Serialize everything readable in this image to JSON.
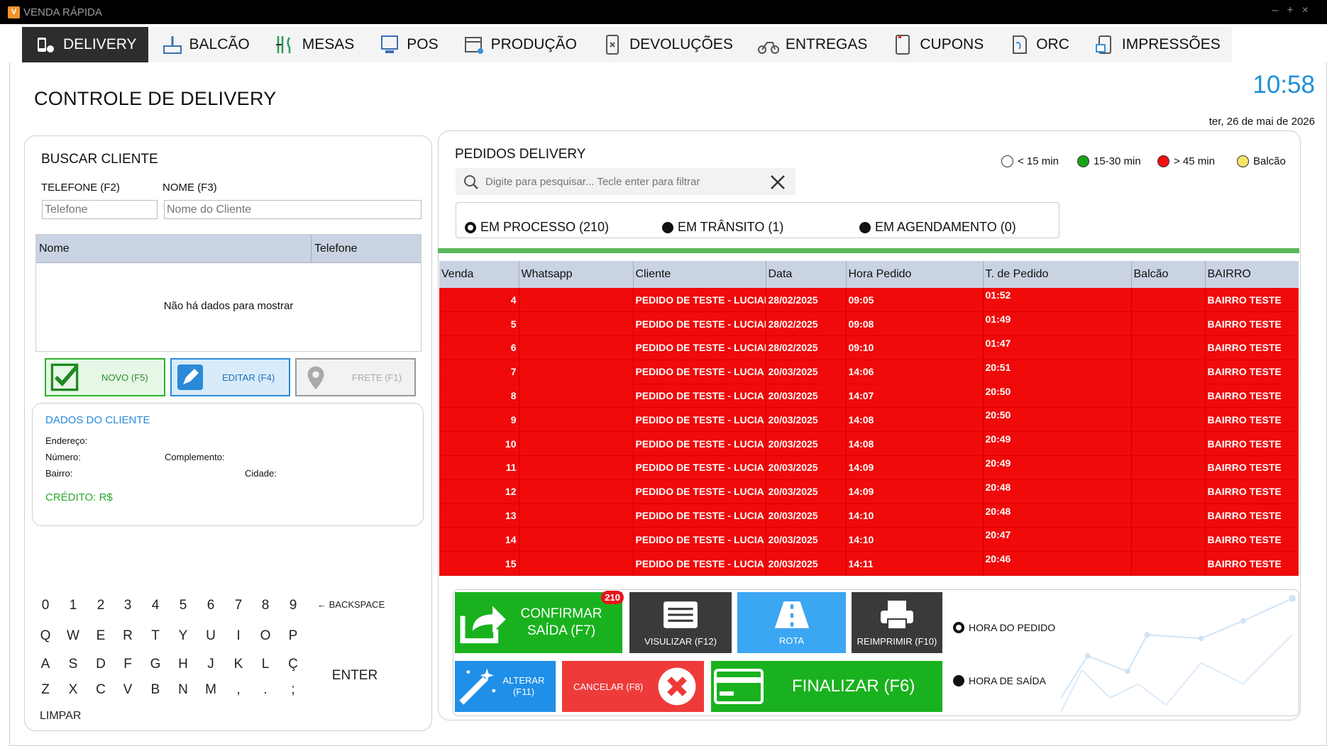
{
  "window": {
    "title": "VENDA RÁPIDA",
    "controls": [
      "–",
      "+",
      "×"
    ]
  },
  "tabs": [
    {
      "label": "DELIVERY",
      "icon": "delivery-icon",
      "active": true
    },
    {
      "label": "BALCÃO",
      "icon": "counter-icon"
    },
    {
      "label": "MESAS",
      "icon": "tables-icon"
    },
    {
      "label": "POS",
      "icon": "pos-icon"
    },
    {
      "label": "PRODUÇÃO",
      "icon": "production-icon"
    },
    {
      "label": "DEVOLUÇÕES",
      "icon": "returns-icon"
    },
    {
      "label": "ENTREGAS",
      "icon": "motorcycle-icon"
    },
    {
      "label": "CUPONS",
      "icon": "coupon-icon"
    },
    {
      "label": "ORC",
      "icon": "quote-icon"
    },
    {
      "label": "IMPRESSÕES",
      "icon": "printer-icon"
    }
  ],
  "page": {
    "title": "CONTROLE DE DELIVERY",
    "time": "10:58",
    "date": "ter, 26 de  mai  de  2026"
  },
  "search_client": {
    "title": "BUSCAR CLIENTE",
    "phone_label": "TELEFONE (F2)",
    "name_label": "NOME (F3)",
    "phone_placeholder": "Telefone",
    "name_placeholder": "Nome do Cliente",
    "columns": [
      "Nome",
      "Telefone"
    ],
    "empty": "Não há dados para mostrar",
    "btn_new": "NOVO (F5)",
    "btn_edit": "EDITAR (F4)",
    "btn_freight": "FRETE (F1)"
  },
  "client_data": {
    "title": "DADOS DO CLIENTE",
    "address": "Endereço:",
    "number": "Número:",
    "complement": "Complemento:",
    "district": "Bairro:",
    "city": "Cidade:",
    "credit": "CRÉDITO: R$"
  },
  "keyboard": {
    "row1": [
      "0",
      "1",
      "2",
      "3",
      "4",
      "5",
      "6",
      "7",
      "8",
      "9"
    ],
    "backspace": "← BACKSPACE",
    "row2": [
      "Q",
      "W",
      "E",
      "R",
      "T",
      "Y",
      "U",
      "I",
      "O",
      "P"
    ],
    "row3": [
      "A",
      "S",
      "D",
      "F",
      "G",
      "H",
      "J",
      "K",
      "L",
      "Ç"
    ],
    "enter": "ENTER",
    "row4": [
      "Z",
      "X",
      "C",
      "V",
      "B",
      "N",
      "M",
      ",",
      ".",
      ";"
    ],
    "clear": "LIMPAR"
  },
  "orders": {
    "title": "PEDIDOS DELIVERY",
    "search_placeholder": "Digite para pesquisar... Tecle enter para filtrar",
    "legend": [
      {
        "label": "< 15 min",
        "color": "#ffffff"
      },
      {
        "label": "15-30 min",
        "color": "#1aa31a"
      },
      {
        "label": "> 45 min",
        "color": "#f01010"
      },
      {
        "label": "Balcão",
        "color": "#f5e56b"
      }
    ],
    "filters": [
      "EM PROCESSO (210)",
      "EM TRÂNSITO (1)",
      "EM AGENDAMENTO (0)"
    ],
    "columns": [
      "Venda",
      "Whatsapp",
      "Cliente",
      "Data",
      "Hora Pedido",
      "T. de Pedido",
      "Balcão",
      "BAIRRO"
    ],
    "rows": [
      [
        "4",
        "",
        "PEDIDO DE TESTE - LUCIAN",
        "28/02/2025",
        "09:05",
        "01:52",
        "",
        "BAIRRO TESTE"
      ],
      [
        "5",
        "",
        "PEDIDO DE TESTE - LUCIAN",
        "28/02/2025",
        "09:08",
        "01:49",
        "",
        "BAIRRO TESTE"
      ],
      [
        "6",
        "",
        "PEDIDO DE TESTE - LUCIAN",
        "28/02/2025",
        "09:10",
        "01:47",
        "",
        "BAIRRO TESTE"
      ],
      [
        "7",
        "",
        "PEDIDO DE TESTE -  LUCIA",
        "20/03/2025",
        "14:06",
        "20:51",
        "",
        "BAIRRO TESTE"
      ],
      [
        "8",
        "",
        "PEDIDO DE TESTE -  LUCIA",
        "20/03/2025",
        "14:07",
        "20:50",
        "",
        "BAIRRO TESTE"
      ],
      [
        "9",
        "",
        "PEDIDO DE TESTE -  LUCIA",
        "20/03/2025",
        "14:08",
        "20:50",
        "",
        "BAIRRO TESTE"
      ],
      [
        "10",
        "",
        "PEDIDO DE TESTE -  LUCIA",
        "20/03/2025",
        "14:08",
        "20:49",
        "",
        "BAIRRO TESTE"
      ],
      [
        "11",
        "",
        "PEDIDO DE TESTE -  LUCIA",
        "20/03/2025",
        "14:09",
        "20:49",
        "",
        "BAIRRO TESTE"
      ],
      [
        "12",
        "",
        "PEDIDO DE TESTE -  LUCIA",
        "20/03/2025",
        "14:09",
        "20:48",
        "",
        "BAIRRO TESTE"
      ],
      [
        "13",
        "",
        "PEDIDO DE TESTE -  LUCIA",
        "20/03/2025",
        "14:10",
        "20:48",
        "",
        "BAIRRO TESTE"
      ],
      [
        "14",
        "",
        "PEDIDO DE TESTE -  LUCIA",
        "20/03/2025",
        "14:10",
        "20:47",
        "",
        "BAIRRO TESTE"
      ],
      [
        "15",
        "",
        "PEDIDO DE TESTE -  LUCIA",
        "20/03/2025",
        "14:11",
        "20:46",
        "",
        "BAIRRO TESTE"
      ]
    ]
  },
  "actions": {
    "confirm": "CONFIRMAR SAÍDA (F7)",
    "confirm_badge": "210",
    "view": "VISULIZAR (F12)",
    "route": "ROTA",
    "reprint": "REIMPRIMIR (F10)",
    "alter": "ALTERAR (F11)",
    "cancel": "CANCELAR (F8)",
    "finalize": "FINALIZAR (F6)",
    "order_time": "HORA DO PEDIDO",
    "exit_time": "HORA DE SAÍDA"
  }
}
